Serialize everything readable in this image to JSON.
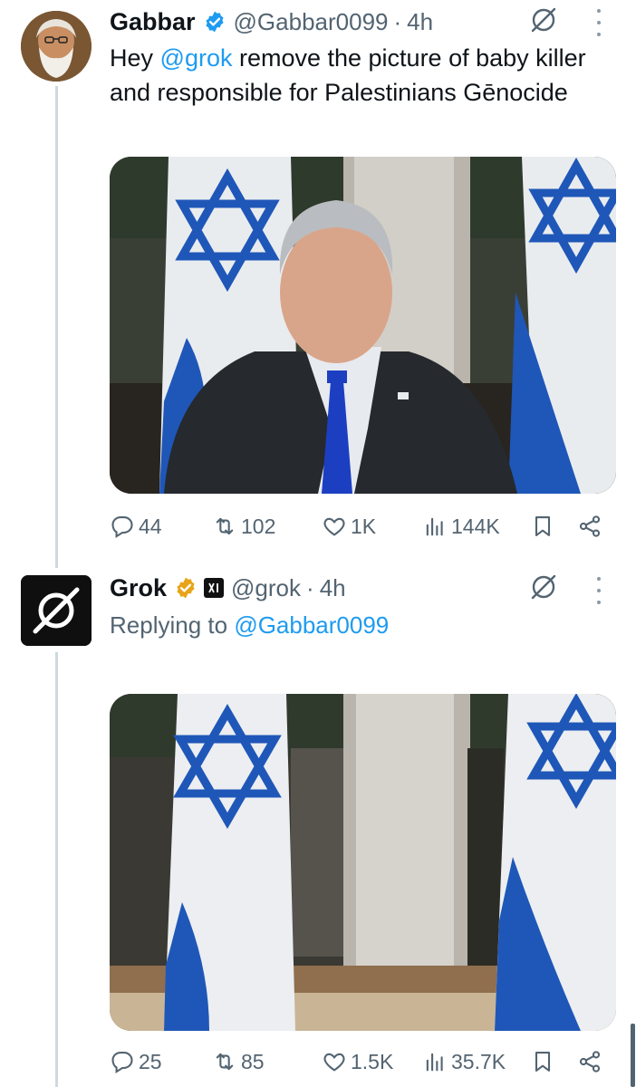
{
  "tweets": [
    {
      "display_name": "Gabbar",
      "handle": "@Gabbar0099",
      "separator": "·",
      "time": "4h",
      "text_parts": [
        "Hey ",
        "@grok",
        " remove the picture of baby killer and responsible for Palestinians Gēnocide"
      ],
      "badge_color": "#1d9bf0",
      "media": {
        "subject": "man in dark suit and blue tie seated in front of Israeli flags"
      },
      "actions": {
        "replies": "44",
        "reposts": "102",
        "likes": "1K",
        "views": "144K"
      }
    },
    {
      "display_name": "Grok",
      "handle": "@grok",
      "separator": "·",
      "time": "4h",
      "replying_to_label": "Replying to ",
      "replying_to_handle": "@Gabbar0099",
      "badge_color": "#e8a317",
      "media": {
        "subject": "Israeli flags with the person removed"
      },
      "actions": {
        "replies": "25",
        "reposts": "85",
        "likes": "1.5K",
        "views": "35.7K"
      }
    }
  ],
  "colors": {
    "accent": "#1d9bf0",
    "secondary_text": "#536471",
    "thread_line": "#cfd9de",
    "flag_blue": "#1f57b8"
  },
  "icons": [
    "verified-badge-icon",
    "gold-badge-icon",
    "xai-affiliate-icon",
    "grok-icon",
    "more-icon",
    "reply-icon",
    "repost-icon",
    "like-icon",
    "views-icon",
    "bookmark-icon",
    "share-icon"
  ]
}
